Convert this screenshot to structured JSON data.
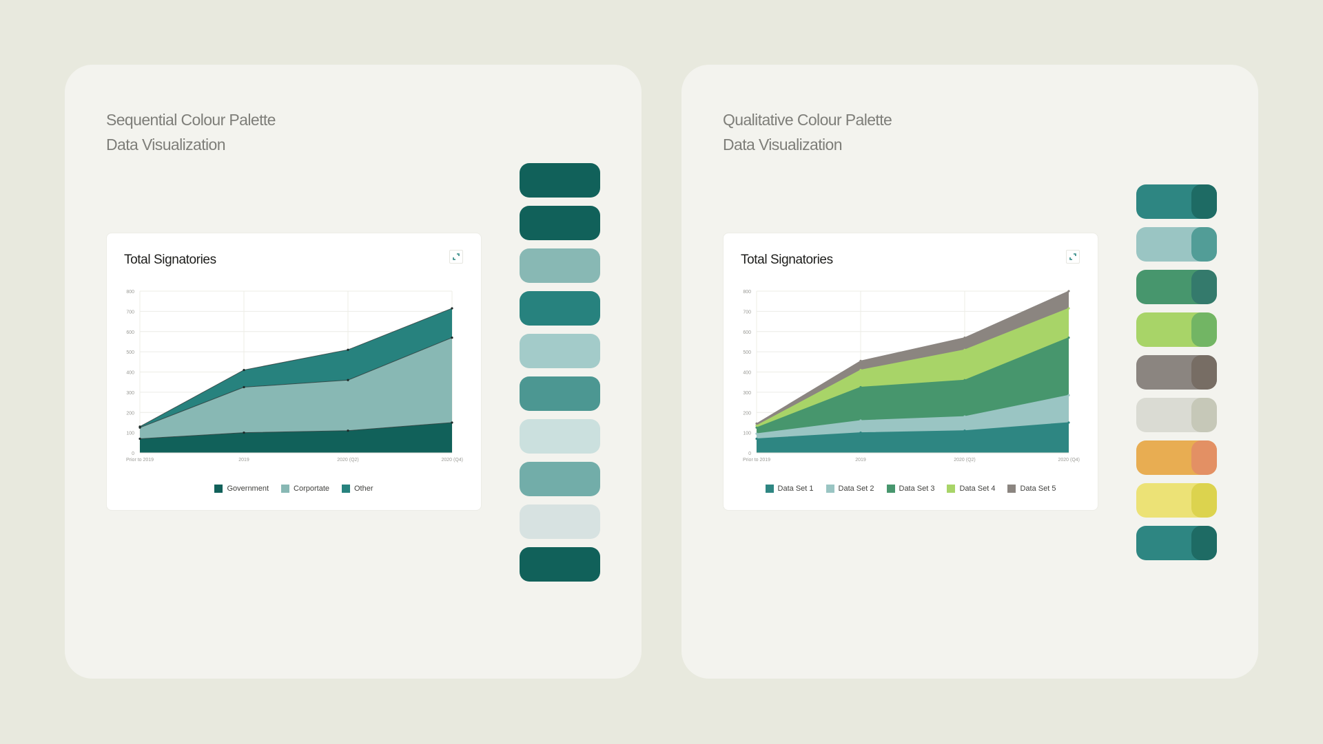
{
  "panels": [
    {
      "id": "sequential",
      "heading_line1": "Sequential Colour Palette",
      "heading_line2": "Data Visualization",
      "card_title": "Total Signatories",
      "expand_icon": "expand-icon",
      "swatches": [
        {
          "color": "#11615a"
        },
        {
          "color": "#11615a"
        },
        {
          "color": "#88b8b4"
        },
        {
          "color": "#27827e"
        },
        {
          "color": "#a3cbc9"
        },
        {
          "color": "#4c9792"
        },
        {
          "color": "#cbe0de"
        },
        {
          "color": "#72ada9"
        },
        {
          "color": "#d7e2e1"
        },
        {
          "color": "#11615a"
        }
      ]
    },
    {
      "id": "qualitative",
      "heading_line1": "Qualitative Colour Palette",
      "heading_line2": "Data Visualization",
      "card_title": "Total Signatories",
      "expand_icon": "expand-icon",
      "swatches": [
        {
          "color": "#2e8682",
          "accent": "#1e6b64"
        },
        {
          "color": "#9ac5c3",
          "accent": "#529d97"
        },
        {
          "color": "#47966d",
          "accent": "#347a6c"
        },
        {
          "color": "#a8d468",
          "accent": "#72b564"
        },
        {
          "color": "#8b8580",
          "accent": "#776d64"
        },
        {
          "color": "#dadbd3",
          "accent": "#c6c8b8"
        },
        {
          "color": "#e8ad52",
          "accent": "#e39064"
        },
        {
          "color": "#ece276",
          "accent": "#dcd34e"
        },
        {
          "color": "#2e8682",
          "accent": "#1e6b64"
        }
      ]
    }
  ],
  "chart_data": [
    {
      "type": "area",
      "stacked": true,
      "title": "Total Signatories",
      "categories": [
        "Prior to 2019",
        "2019",
        "2020 (Q2)",
        "2020 (Q4)"
      ],
      "ylim": [
        0,
        800
      ],
      "yticks": [
        0,
        100,
        200,
        300,
        400,
        500,
        600,
        700,
        800
      ],
      "grid": true,
      "legend_position": "bottom",
      "series": [
        {
          "name": "Government",
          "color": "#11615a",
          "values": [
            70,
            100,
            110,
            150
          ]
        },
        {
          "name": "Corportate",
          "color": "#88b8b4",
          "values": [
            55,
            225,
            250,
            420
          ]
        },
        {
          "name": "Other",
          "color": "#27827e",
          "values": [
            5,
            85,
            150,
            145
          ]
        }
      ]
    },
    {
      "type": "area",
      "stacked": true,
      "title": "Total Signatories",
      "categories": [
        "Prior to 2019",
        "2019",
        "2020 (Q2)",
        "2020 (Q4)"
      ],
      "ylim": [
        0,
        800
      ],
      "yticks": [
        0,
        100,
        200,
        300,
        400,
        500,
        600,
        700,
        800
      ],
      "grid": true,
      "legend_position": "bottom",
      "series": [
        {
          "name": "Data Set 1",
          "color": "#2e8682",
          "values": [
            70,
            100,
            110,
            150
          ]
        },
        {
          "name": "Data Set 2",
          "color": "#9ac5c3",
          "values": [
            25,
            60,
            70,
            135
          ]
        },
        {
          "name": "Data Set 3",
          "color": "#47966d",
          "values": [
            30,
            165,
            180,
            285
          ]
        },
        {
          "name": "Data Set 4",
          "color": "#a8d468",
          "values": [
            10,
            85,
            150,
            145
          ]
        },
        {
          "name": "Data Set 5",
          "color": "#8b8580",
          "values": [
            10,
            45,
            60,
            85
          ]
        }
      ]
    }
  ]
}
